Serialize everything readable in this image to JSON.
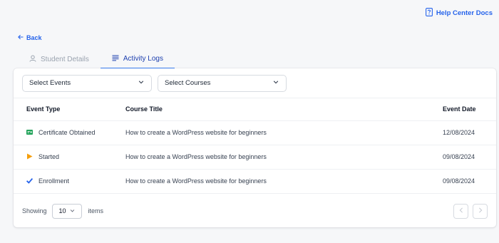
{
  "header": {
    "help_label": "Help Center Docs",
    "help_icon": "help-doc-icon"
  },
  "nav": {
    "back_label": "Back"
  },
  "tabs": [
    {
      "label": "Student Details",
      "icon": "user-icon",
      "active": false
    },
    {
      "label": "Activity Logs",
      "icon": "list-icon",
      "active": true
    }
  ],
  "filters": {
    "events_label": "Select Events",
    "courses_label": "Select Courses"
  },
  "table": {
    "headers": {
      "event_type": "Event Type",
      "course_title": "Course Title",
      "event_date": "Event Date"
    },
    "rows": [
      {
        "event": "Certificate Obtained",
        "icon": "certificate-icon",
        "course": "How to create a WordPress website for beginners",
        "date": "12/08/2024"
      },
      {
        "event": "Started",
        "icon": "play-icon",
        "course": "How to create a WordPress website for beginners",
        "date": "09/08/2024"
      },
      {
        "event": "Enrollment",
        "icon": "checkmark-icon",
        "course": "How to create a WordPress website for beginners",
        "date": "09/08/2024"
      }
    ]
  },
  "footer": {
    "showing_label": "Showing",
    "per_page": "10",
    "items_label": "items"
  },
  "colors": {
    "accent": "#2563eb",
    "certificate": "#22a35a",
    "started": "#f59e0b",
    "enrollment": "#2563eb"
  }
}
